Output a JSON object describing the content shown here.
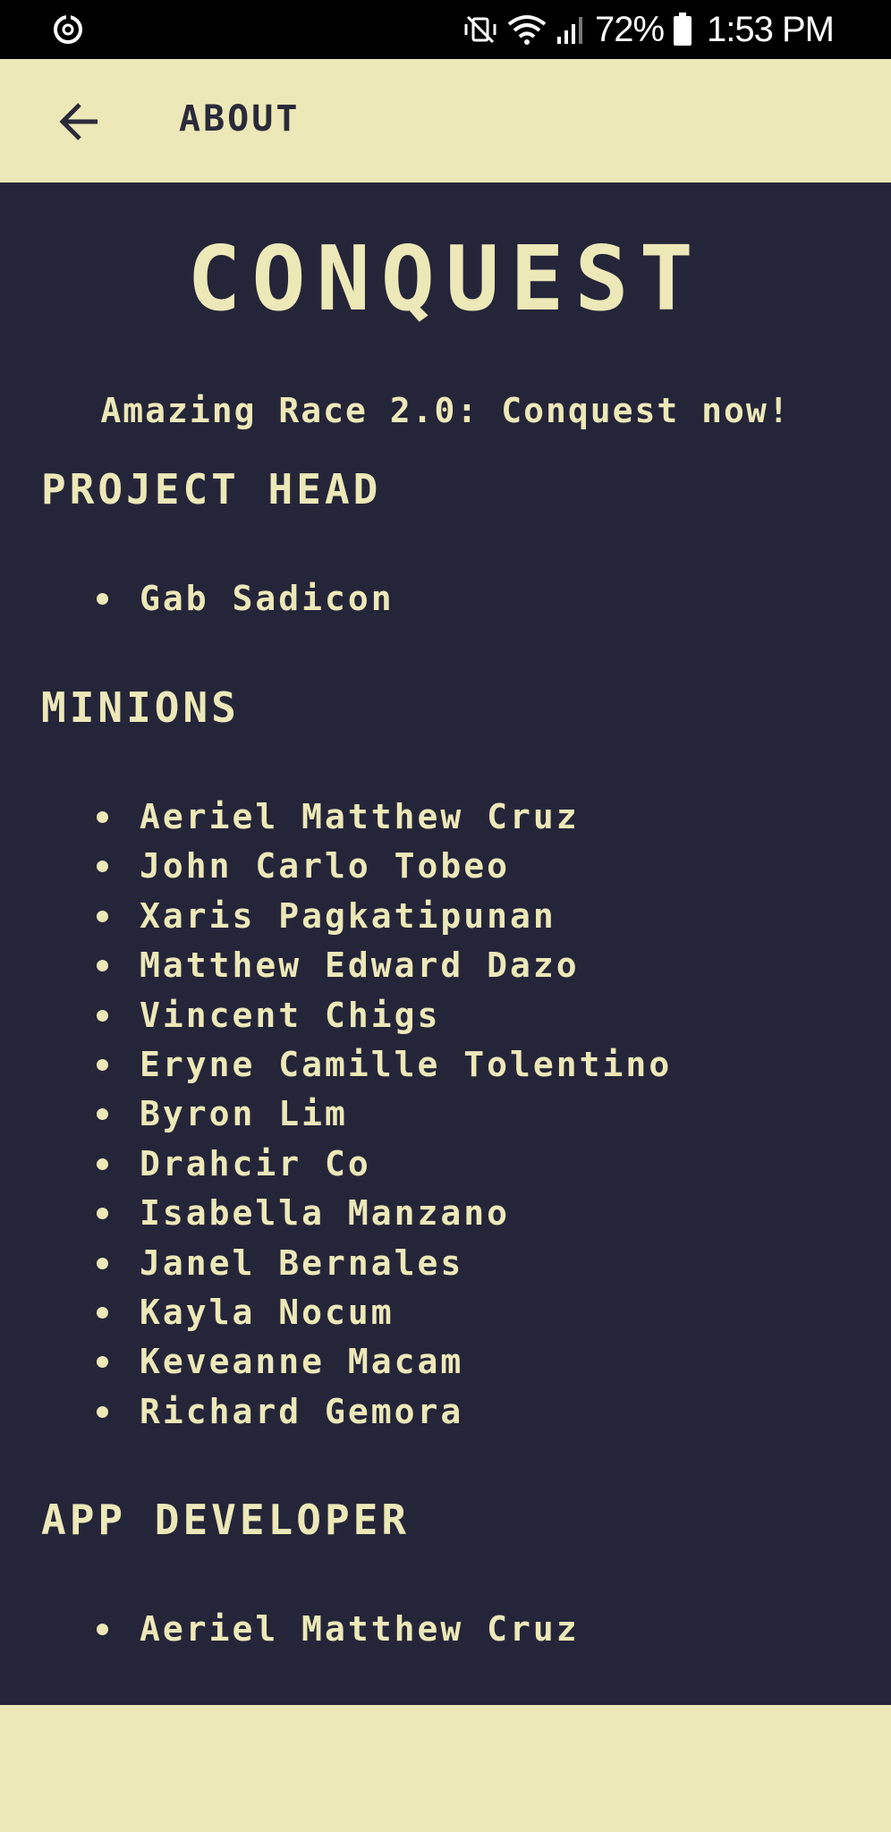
{
  "status_bar": {
    "left_icon": "sync-circle-icon",
    "mute_icon": "vibrate-mute-icon",
    "wifi_icon": "wifi-icon",
    "signal_icon": "signal-bars-icon",
    "battery_percent": "72%",
    "battery_icon": "battery-icon",
    "time": "1:53 PM"
  },
  "app_bar": {
    "back_icon": "arrow-left-icon",
    "title": "ABOUT"
  },
  "main": {
    "title": "CONQUEST",
    "tagline": "Amazing Race 2.0: Conquest now!",
    "sections": [
      {
        "heading": "PROJECT HEAD",
        "names": [
          "Gab Sadicon"
        ]
      },
      {
        "heading": "MINIONS",
        "names": [
          "Aeriel Matthew Cruz",
          "John Carlo Tobeo",
          "Xaris Pagkatipunan",
          "Matthew Edward Dazo",
          "Vincent Chigs",
          "Eryne Camille Tolentino",
          "Byron Lim",
          "Drahcir Co",
          "Isabella Manzano",
          "Janel Bernales",
          "Kayla Nocum",
          "Keveanne Macam",
          "Richard Gemora"
        ]
      },
      {
        "heading": "APP DEVELOPER",
        "names": [
          "Aeriel Matthew Cruz"
        ]
      }
    ]
  },
  "colors": {
    "background": "#252539",
    "cream": "#ede8b8",
    "text": "#ece8b8",
    "app_bar_text": "#2a2a3a"
  }
}
